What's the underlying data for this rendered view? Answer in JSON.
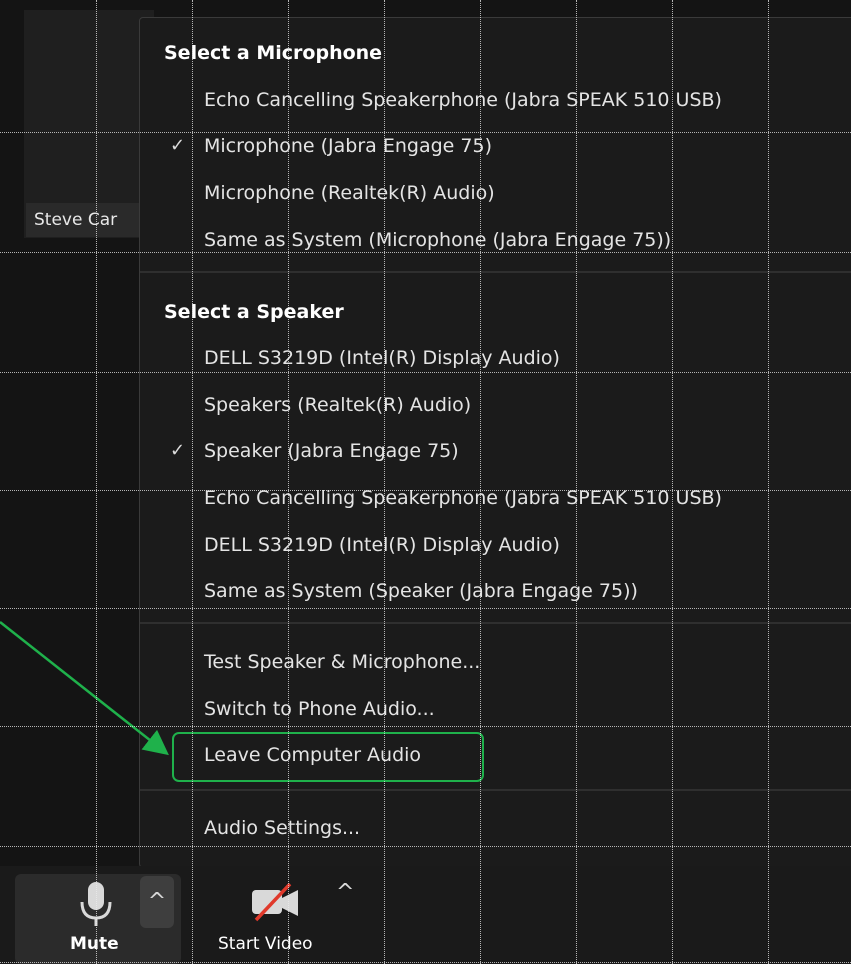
{
  "participant": {
    "name": "Steve Car"
  },
  "menu": {
    "microphone_section": {
      "title": "Select a Microphone",
      "items": [
        {
          "label": "Echo Cancelling Speakerphone (Jabra SPEAK 510 USB)",
          "checked": false
        },
        {
          "label": "Microphone (Jabra Engage 75)",
          "checked": true
        },
        {
          "label": "Microphone (Realtek(R) Audio)",
          "checked": false
        },
        {
          "label": "Same as System (Microphone (Jabra Engage 75))",
          "checked": false
        }
      ]
    },
    "speaker_section": {
      "title": "Select a Speaker",
      "items": [
        {
          "label": "DELL S3219D (Intel(R) Display Audio)",
          "checked": false
        },
        {
          "label": "Speakers (Realtek(R) Audio)",
          "checked": false
        },
        {
          "label": "Speaker (Jabra Engage 75)",
          "checked": true
        },
        {
          "label": "Echo Cancelling Speakerphone (Jabra SPEAK 510 USB)",
          "checked": false
        },
        {
          "label": "DELL S3219D (Intel(R) Display Audio)",
          "checked": false
        },
        {
          "label": "Same as System (Speaker (Jabra Engage 75))",
          "checked": false
        }
      ]
    },
    "actions": [
      {
        "label": "Test Speaker & Microphone..."
      },
      {
        "label": "Switch to Phone Audio..."
      },
      {
        "label": "Leave Computer Audio",
        "highlighted": true
      }
    ],
    "settings": {
      "label": "Audio Settings..."
    },
    "check_glyph": "✓"
  },
  "toolbar": {
    "mute_label": "Mute",
    "start_video_label": "Start Video",
    "caret_glyph": "^",
    "mic_icon": "microphone-icon",
    "video_icon": "video-off-icon"
  },
  "annotation": {
    "color": "#1fb14b"
  }
}
